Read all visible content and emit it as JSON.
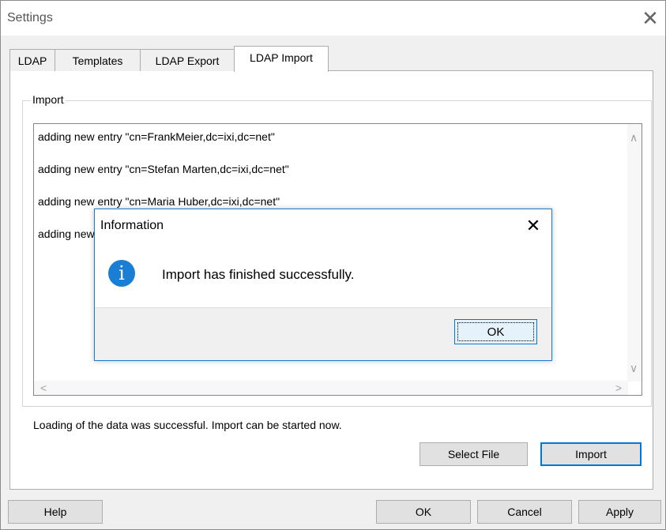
{
  "window": {
    "title": "Settings",
    "close_glyph": "✕"
  },
  "tabs": [
    {
      "label": "LDAP"
    },
    {
      "label": "Templates"
    },
    {
      "label": "LDAP Export"
    },
    {
      "label": "LDAP Import",
      "active": true
    }
  ],
  "import_group": {
    "label": "Import"
  },
  "log_lines": [
    "adding new entry \"cn=FrankMeier,dc=ixi,dc=net\"",
    "adding new entry \"cn=Stefan Marten,dc=ixi,dc=net\"",
    "adding new entry \"cn=Maria Huber,dc=ixi,dc=net\"",
    "adding new entry \"cn=Peter Schmidt,dc=ixi,dc=net\""
  ],
  "scrollbar_arrows": {
    "up": "∧",
    "down": "∨",
    "left": "<",
    "right": ">"
  },
  "status_text": "Loading of the data was successful. Import can be started now.",
  "panel_buttons": {
    "select_file": "Select File",
    "import": "Import"
  },
  "footer_buttons": {
    "help": "Help",
    "ok": "OK",
    "cancel": "Cancel",
    "apply": "Apply"
  },
  "dialog": {
    "title": "Information",
    "close_glyph": "✕",
    "icon": "info-icon",
    "icon_glyph": "i",
    "message": "Import has finished successfully.",
    "ok_label": "OK"
  },
  "colors": {
    "accent": "#0078d7",
    "info_icon": "#1a7fd4",
    "window_bg": "#f0f0f0"
  }
}
